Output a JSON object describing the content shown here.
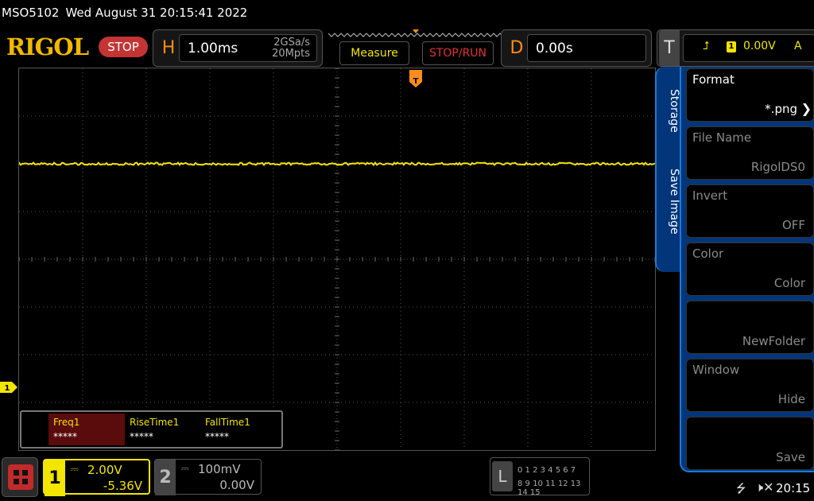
{
  "status_line": {
    "model": "MSO5102",
    "datetime": "Wed August 31 20:15:41 2022"
  },
  "brand": {
    "logo": "RIGOL",
    "run_state": "STOP"
  },
  "horizontal": {
    "key": "H",
    "timebase": "1.00ms",
    "sample_rate": "2GSa/s",
    "memory_depth": "20Mpts"
  },
  "buttons": {
    "measure": "Measure",
    "stop_run": "STOP/RUN"
  },
  "delay": {
    "key": "D",
    "value": "0.00s"
  },
  "trigger": {
    "key": "T",
    "edge_icon": "rising-edge-icon",
    "source": "1",
    "level": "0.00V",
    "mode": "A"
  },
  "markers": {
    "trigger_position": "T",
    "ch1_reference": "1"
  },
  "measurements": [
    {
      "name": "Freq1",
      "value": "*****",
      "active": true
    },
    {
      "name": "RiseTime1",
      "value": "*****",
      "active": false
    },
    {
      "name": "FallTime1",
      "value": "*****",
      "active": false
    }
  ],
  "menu": {
    "tabs": [
      "Storage",
      "Save Image"
    ],
    "items": [
      {
        "title": "Format",
        "value": "*.png",
        "enabled": true,
        "arrow": true
      },
      {
        "title": "File Name",
        "value": "RigolDS0",
        "enabled": false,
        "arrow": false
      },
      {
        "title": "Invert",
        "value": "OFF",
        "enabled": false,
        "arrow": false
      },
      {
        "title": "Color",
        "value": "Color",
        "enabled": false,
        "arrow": false
      },
      {
        "title": "",
        "value": "NewFolder",
        "enabled": false,
        "arrow": false
      },
      {
        "title": "Window",
        "value": "Hide",
        "enabled": false,
        "arrow": false
      },
      {
        "title": "",
        "value": "Save",
        "enabled": false,
        "arrow": false
      }
    ]
  },
  "channels": [
    {
      "num": "1",
      "coupling_icon": "dc-coupling-icon",
      "scale": "2.00V",
      "offset": "-5.36V",
      "color": "#f2e500",
      "active": true
    },
    {
      "num": "2",
      "coupling_icon": "dc-coupling-icon",
      "scale": "100mV",
      "offset": "0.00V",
      "color": "#bbbbbb",
      "active": false
    }
  ],
  "logic_analyzer": {
    "key": "L",
    "row1": "0 1 2 3  4 5 6 7",
    "row2": "8 9 10 11 12 13 14 15"
  },
  "system": {
    "clock": "20:15",
    "icons": [
      "usb-icon",
      "sound-muted-icon"
    ]
  },
  "trace": {
    "color": "#f2e500",
    "level_div": 2.0
  },
  "colors": {
    "accent": "#f2e500",
    "menu_blue": "#02357a",
    "stop_red": "#c43434"
  }
}
